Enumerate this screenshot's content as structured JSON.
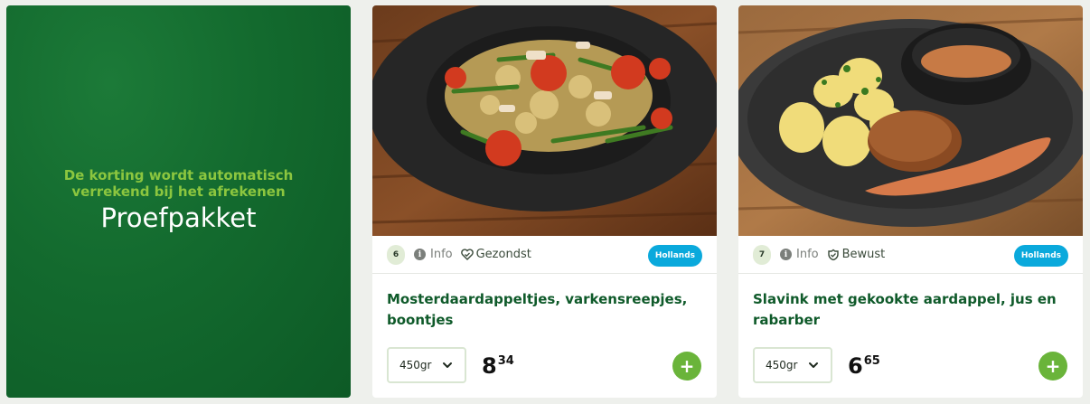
{
  "promo": {
    "subtitle": "De korting wordt automatisch verrekend bij het afrekenen",
    "title": "Proefpakket"
  },
  "products": [
    {
      "number": "6",
      "info_label": "Info",
      "tag_label": "Gezondst",
      "tag_icon": "heart-check-icon",
      "cuisine": "Hollands",
      "title": "Mosterdaardappeltjes, varkensreepjes, boontjes",
      "weight": "450gr",
      "price_int": "8",
      "price_dec": "34",
      "add_label": "+"
    },
    {
      "number": "7",
      "info_label": "Info",
      "tag_label": "Bewust",
      "tag_icon": "leaf-check-icon",
      "cuisine": "Hollands",
      "title": "Slavink met gekookte aardappel, jus en rabarber",
      "weight": "450gr",
      "price_int": "6",
      "price_dec": "65",
      "add_label": "+"
    }
  ],
  "colors": {
    "brand_green": "#136a2e",
    "accent_green": "#6ab43a",
    "title_green": "#0f5a2a",
    "cuisine_blue": "#0aa9dc"
  }
}
